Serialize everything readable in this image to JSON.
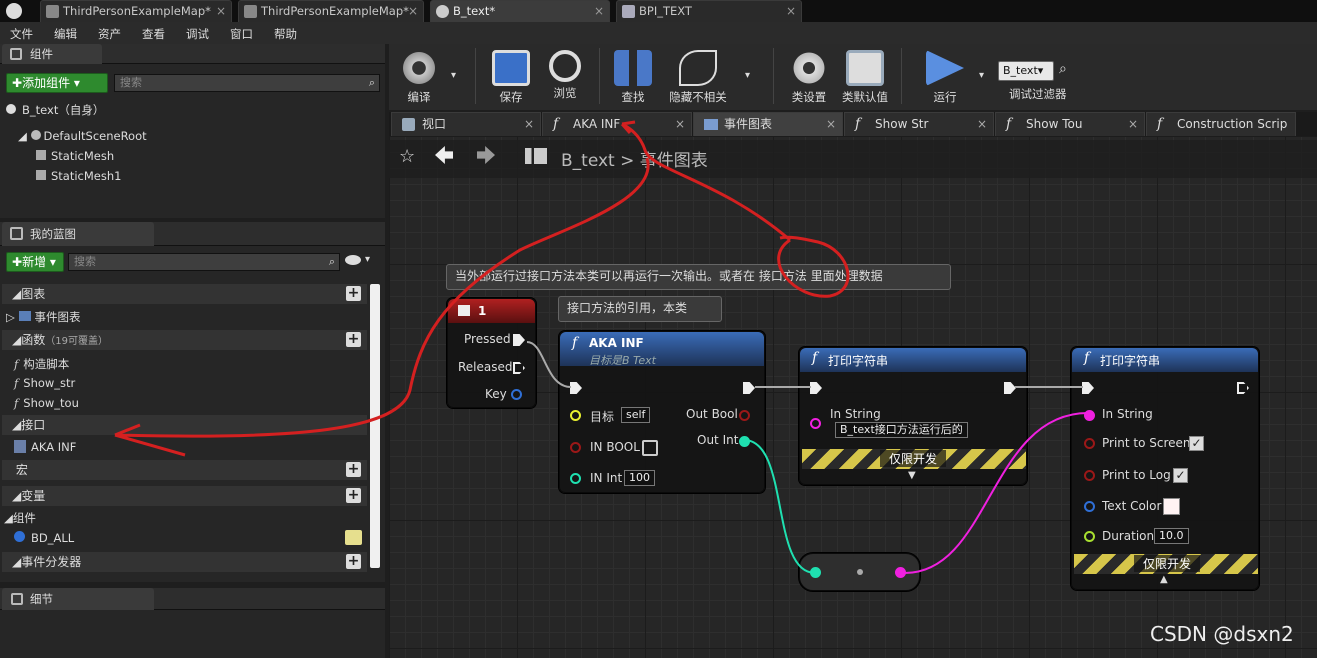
{
  "window_tabs": [
    {
      "label": "ThirdPersonExampleMap*"
    },
    {
      "label": "ThirdPersonExampleMap*"
    },
    {
      "label": "B_text*"
    },
    {
      "label": "BPI_TEXT"
    }
  ],
  "menu": [
    "文件",
    "编辑",
    "资产",
    "查看",
    "调试",
    "窗口",
    "帮助"
  ],
  "components_panel": {
    "title": "组件",
    "add_button": "添加组件",
    "search_placeholder": "搜索",
    "root_item": "B_text（自身）",
    "tree": [
      "DefaultSceneRoot",
      "StaticMesh",
      "StaticMesh1"
    ]
  },
  "my_blueprint": {
    "title": "我的蓝图",
    "new_button": "新增",
    "search_placeholder": "搜索",
    "sections": {
      "graphs": "图表",
      "event_graph": "事件图表",
      "functions": "函数",
      "functions_note": "（19可覆盖）",
      "construction": "构造脚本",
      "show_str": "Show_str",
      "show_tou": "Show_tou",
      "interfaces": "接口",
      "aka_inf": "AKA INF",
      "macros": "宏",
      "variables": "变量",
      "components": "组件",
      "bd_all": "BD_ALL",
      "dispatchers": "事件分发器"
    }
  },
  "details_panel": {
    "title": "细节"
  },
  "toolbar": {
    "compile": "编译",
    "save": "保存",
    "browse": "浏览",
    "find": "查找",
    "hide_unrelated": "隐藏不相关",
    "class_settings": "类设置",
    "class_defaults": "类默认值",
    "play": "运行",
    "debug_object": "B_text",
    "debug_filter": "调试过滤器"
  },
  "graph_tabs": [
    {
      "label": "视口"
    },
    {
      "label": "AKA INF"
    },
    {
      "label": "事件图表"
    },
    {
      "label": "Show Str"
    },
    {
      "label": "Show Tou"
    },
    {
      "label": "Construction Scrip"
    }
  ],
  "breadcrumb": {
    "blueprint": "B_text",
    "separator": ">",
    "graph": "事件图表"
  },
  "comments": {
    "main": "当外部运行过接口方法本类可以再运行一次输出。或者在 接口方法 里面处理数据",
    "ref": "接口方法的引用，本类"
  },
  "key_node": {
    "title": "1",
    "pressed": "Pressed",
    "released": "Released",
    "key": "Key"
  },
  "aka_node": {
    "title": "AKA INF",
    "subtitle": "目标是B Text",
    "target": "目标",
    "target_value": "self",
    "in_bool": "IN BOOL",
    "in_int": "IN Int",
    "in_int_value": "100",
    "out_bool": "Out Bool",
    "out_int": "Out Int"
  },
  "print1": {
    "title": "打印字符串",
    "in_string": "In String",
    "in_string_value": "B_text接口方法运行后的",
    "dev_only": "仅限开发"
  },
  "print2": {
    "title": "打印字符串",
    "in_string": "In String",
    "print_screen": "Print to Screen",
    "print_log": "Print to Log",
    "text_color": "Text Color",
    "duration": "Duration",
    "duration_value": "10.0",
    "dev_only": "仅限开发"
  },
  "watermark": "CSDN @dsxn2",
  "colors": {
    "exec": "#eeeeee",
    "int_pin": "#1fe0b0",
    "string_pin": "#f020e0",
    "bool_pin": "#9b1818",
    "object_pin": "#1a6cf0",
    "vector_pin": "#e8f030",
    "annotation": "#d42020",
    "accent_blue": "#2f6fd6"
  }
}
